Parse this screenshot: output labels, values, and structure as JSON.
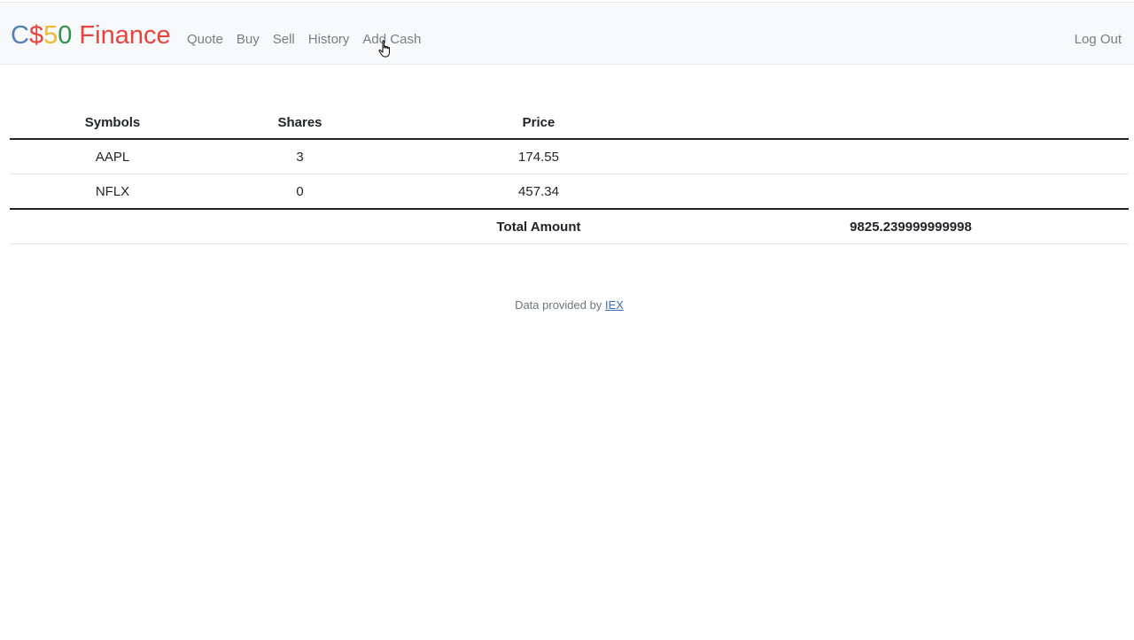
{
  "brand": {
    "part1": "C",
    "part2": "$",
    "part3": "5",
    "part4": "0",
    "part5": " Finance",
    "colors": {
      "blue": "#537fbe",
      "red": "#ea433b",
      "yellow": "#f5b82e",
      "green": "#2e944b"
    }
  },
  "nav": {
    "items": [
      {
        "label": "Quote"
      },
      {
        "label": "Buy"
      },
      {
        "label": "Sell"
      },
      {
        "label": "History"
      },
      {
        "label": "Add Cash"
      }
    ],
    "logout_label": "Log Out"
  },
  "table": {
    "headers": [
      "Symbols",
      "Shares",
      "Price",
      ""
    ],
    "rows": [
      {
        "symbol": "AAPL",
        "shares": "3",
        "price": "174.55"
      },
      {
        "symbol": "NFLX",
        "shares": "0",
        "price": "457.34"
      }
    ],
    "total_label": "Total Amount",
    "total_value": "9825.239999999998"
  },
  "footer": {
    "prefix": "Data provided by ",
    "link_label": "IEX"
  },
  "cursor": {
    "icon": "hand-pointer-icon"
  }
}
